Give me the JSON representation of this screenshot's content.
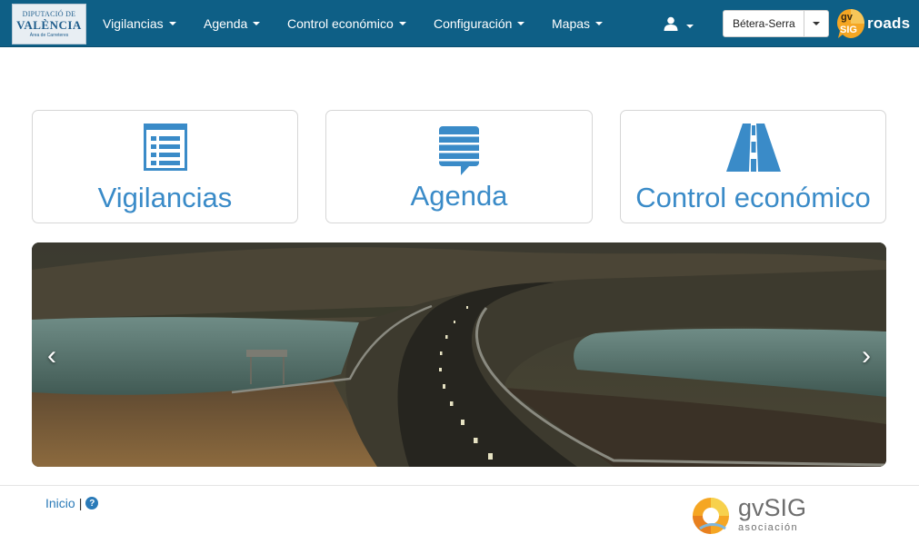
{
  "brand": {
    "logo_line1": "DIPUTACIÓ DE",
    "logo_line2": "VALÈNCIA",
    "logo_line3": "Àrea de Carreteres"
  },
  "nav": {
    "items": [
      {
        "label": "Vigilancias"
      },
      {
        "label": "Agenda"
      },
      {
        "label": "Control económico"
      },
      {
        "label": "Configuración"
      },
      {
        "label": "Mapas"
      }
    ],
    "user_icon": "user-icon",
    "location_select": {
      "value": "Bétera-Serra"
    },
    "app_logo": {
      "prefix": "gv",
      "sig": "SIG",
      "text": "roads"
    }
  },
  "tiles": [
    {
      "label": "Vigilancias",
      "icon": "list-icon"
    },
    {
      "label": "Agenda",
      "icon": "comment-icon"
    },
    {
      "label": "Control económico",
      "icon": "road-icon"
    }
  ],
  "carousel": {
    "prev": "‹",
    "next": "›"
  },
  "footer": {
    "home_link": "Inicio",
    "separator": "|",
    "help": "?",
    "assoc_logo": {
      "name": "gvSIG",
      "sub": "asociación"
    }
  },
  "colors": {
    "navbar": "#0e5f86",
    "accent": "#3a8bc8",
    "link": "#2a7ab8"
  }
}
